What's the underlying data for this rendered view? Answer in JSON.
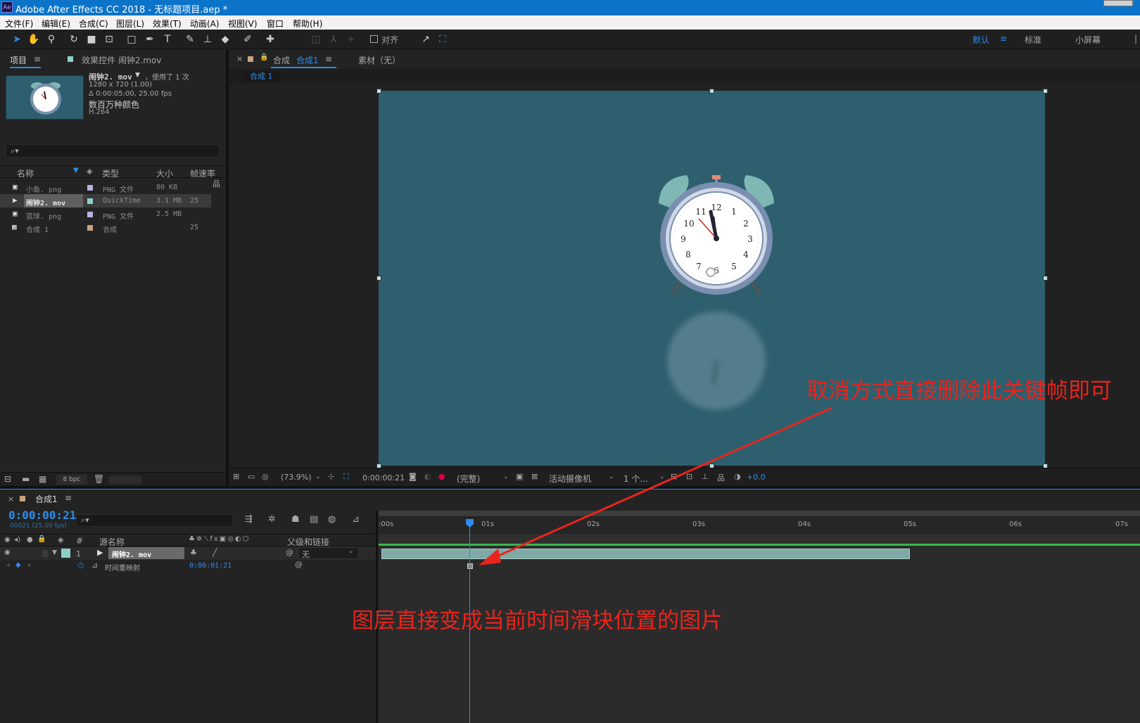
{
  "app": {
    "title": "Adobe After Effects CC 2018 - 无标题项目.aep *",
    "badge": "Ae"
  },
  "menu": [
    "文件(F)",
    "编辑(E)",
    "合成(C)",
    "图层(L)",
    "效果(T)",
    "动画(A)",
    "视图(V)",
    "窗口",
    "帮助(H)"
  ],
  "toolbar": {
    "snap_label": "对齐",
    "workspaces": [
      "默认",
      "标准",
      "小屏幕"
    ],
    "ws_menu_icon": "≡"
  },
  "project": {
    "tab": "项目",
    "tab_menu": "≡",
    "effects_tab": "效果控件 闹钟2.mov",
    "preview": {
      "name": "闹钟2. mov",
      "used": "，使用了 1 次",
      "dims": "1280 x 720 (1.00)",
      "dur": "Δ 0:00:05:00, 25.00 fps",
      "colors": "数百万种颜色",
      "codec": "H.264"
    },
    "search_icon": "⌕▾",
    "columns": [
      "名称",
      "类型",
      "大小",
      "帧速率"
    ],
    "rows": [
      {
        "name": "小鱼. png",
        "type": "PNG 文件",
        "size": "80 KB",
        "fps": "",
        "color": "#b9b3e3"
      },
      {
        "name": "闹钟2. mov",
        "type": "QuickTime",
        "size": "3.1 MB",
        "fps": "25",
        "color": "#8fcfc7"
      },
      {
        "name": "篮球. png",
        "type": "PNG 文件",
        "size": "2.5 MB",
        "fps": "",
        "color": "#b9b3e3"
      },
      {
        "name": "合成 1",
        "type": "合成",
        "size": "",
        "fps": "25",
        "color": "#c8a47c"
      }
    ],
    "bpc": "8 bpc"
  },
  "comp": {
    "tab_prefix": "合成",
    "tab_name": "合成1",
    "tab_menu": "≡",
    "footage_tab": "素材（无）",
    "crumb": "合成 1",
    "zoom": "(73.9%)",
    "time": "0:00:00:21",
    "quality": "(完整)",
    "camera": "活动摄像机",
    "views": "1 个...",
    "exposure": "+0.0",
    "bg_color": "#2e5f6e"
  },
  "clock": {
    "numbers": [
      "12",
      "1",
      "2",
      "3",
      "4",
      "5",
      "6",
      "7",
      "8",
      "9",
      "10",
      "11"
    ]
  },
  "timeline": {
    "tab": "合成1",
    "tab_menu": "≡",
    "timecode": "0:00:00:21",
    "fps_note": "00021 (25.00 fps)",
    "search_icon": "⌕▾",
    "col_num": "#",
    "col_source": "源名称",
    "col_parent": "父级和链接",
    "layer": {
      "index": "1",
      "name": "闹钟2. mov",
      "parent": "无"
    },
    "prop": {
      "name": "时间重映射",
      "value": "0:00:01:21"
    },
    "ticks": [
      ":00s",
      "01s",
      "02s",
      "03s",
      "04s",
      "05s",
      "06s",
      "07s"
    ]
  },
  "annotations": {
    "top": "取消方式直接删除此关键帧即可",
    "bottom": "图层直接变成当前时间滑块位置的图片"
  }
}
